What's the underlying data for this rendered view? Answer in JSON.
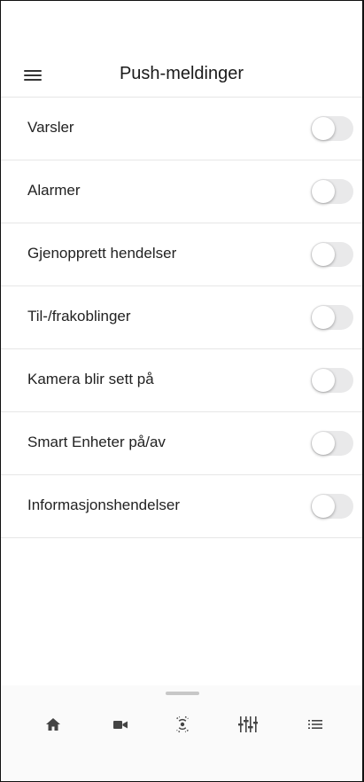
{
  "header": {
    "title": "Push-meldinger",
    "menu_icon": "hamburger-menu-icon"
  },
  "settings": [
    {
      "label": "Varsler",
      "enabled": false
    },
    {
      "label": "Alarmer",
      "enabled": false
    },
    {
      "label": "Gjenopprett hendelser",
      "enabled": false
    },
    {
      "label": "Til-/frakoblinger",
      "enabled": false
    },
    {
      "label": "Kamera blir sett på",
      "enabled": false
    },
    {
      "label": "Smart Enheter på/av",
      "enabled": false
    },
    {
      "label": "Informasjonshendelser",
      "enabled": false
    }
  ],
  "bottom_nav": {
    "items": [
      {
        "icon": "home-icon"
      },
      {
        "icon": "video-camera-icon"
      },
      {
        "icon": "sensor-icon"
      },
      {
        "icon": "equalizer-icon"
      },
      {
        "icon": "list-icon"
      }
    ]
  },
  "colors": {
    "toggle_off": "#e9e9ea",
    "divider": "#e6e6e6",
    "icon": "#444444"
  }
}
